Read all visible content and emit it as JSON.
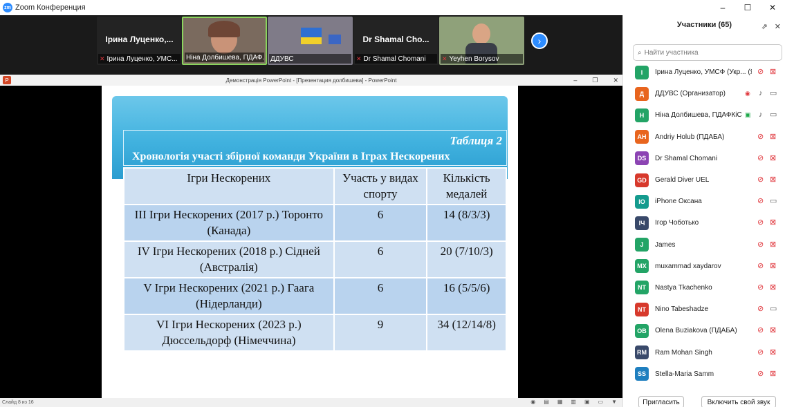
{
  "window": {
    "title": "Zoom Конференция",
    "controls": [
      "–",
      "☐",
      "✕"
    ]
  },
  "video_strip": {
    "tiles": [
      {
        "big_name": "Ірина Луценко,...",
        "caption": "Ірина Луценко, УМС...",
        "muted": true
      },
      {
        "big_name": "",
        "caption": "Ніна Долбишева, ПДАФ...",
        "muted": false
      },
      {
        "big_name": "",
        "caption": "ДДУВС",
        "muted": false
      },
      {
        "big_name": "Dr Shamal Cho...",
        "caption": "Dr Shamal Chomani",
        "muted": true
      },
      {
        "big_name": "",
        "caption": "Yeyhen Borysov",
        "muted": true
      }
    ],
    "next_icon": "chevron-right-icon"
  },
  "powerpoint": {
    "window_title": "Демонстрація PowerPoint - [Презентация долбишева] - PowerPoint",
    "status_text": "Слайд 8 из 16",
    "slide": {
      "caption_label": "Таблиця 2",
      "caption_title": "Хронологія участі збірної команди України в Іграх Нескорених",
      "table": {
        "headers": [
          "Ігри Нескорених",
          "Участь у видах спорту",
          "Кількість медалей"
        ],
        "rows": [
          [
            "III Ігри Нескорених (2017 р.) Торонто (Канада)",
            "6",
            "14 (8/3/3)"
          ],
          [
            "IV Ігри Нескорених (2018 р.) Сідней (Австралія)",
            "6",
            "20 (7/10/3)"
          ],
          [
            "V Ігри Нескорених (2021 р.) Гаага (Нідерланди)",
            "6",
            "16 (5/5/6)"
          ],
          [
            "VI Ігри Нескорених (2023 р.) Дюссельдорф (Німеччина)",
            "9",
            "34 (12/14/8)"
          ]
        ]
      }
    }
  },
  "participants_panel": {
    "title": "Участники (65)",
    "search_placeholder": "Найти участника",
    "participants": [
      {
        "initials": "І",
        "name": "Ірина Луценко, УМСФ (Укр... (Я)",
        "color": "#23a466",
        "mic": "off",
        "cam": "off"
      },
      {
        "initials": "Д",
        "name": "ДДУВС (Организатор)",
        "color": "#e8651e",
        "mic": "on",
        "cam": "on",
        "extra": "rec"
      },
      {
        "initials": "Н",
        "name": "Ніна Долбишева, ПДАФКіС",
        "color": "#23a466",
        "mic": "on",
        "cam": "on",
        "extra": "share"
      },
      {
        "initials": "AH",
        "name": "Andriy Holub (ПДАБА)",
        "color": "#e8651e",
        "mic": "off",
        "cam": "off"
      },
      {
        "initials": "DS",
        "name": "Dr  Shamal Chomani",
        "color": "#8c44b3",
        "mic": "off",
        "cam": "off"
      },
      {
        "initials": "GD",
        "name": "Gerald Diver UEL",
        "color": "#d7392c",
        "mic": "off",
        "cam": "off"
      },
      {
        "initials": "IO",
        "name": "iPhone Оксана",
        "color": "#149b8e",
        "mic": "off",
        "cam": "on"
      },
      {
        "initials": "ІЧ",
        "name": "Ігор Чоботько",
        "color": "#39496a",
        "mic": "off",
        "cam": "off"
      },
      {
        "initials": "J",
        "name": "James",
        "color": "#23a466",
        "mic": "off",
        "cam": "off"
      },
      {
        "initials": "MX",
        "name": "muxammad xaydarov",
        "color": "#23a466",
        "mic": "off",
        "cam": "off"
      },
      {
        "initials": "NT",
        "name": "Nastya Tkachenko",
        "color": "#23a466",
        "mic": "off",
        "cam": "off"
      },
      {
        "initials": "NT",
        "name": "Nino Tabeshadze",
        "color": "#d7392c",
        "mic": "off",
        "cam": "on"
      },
      {
        "initials": "OB",
        "name": "Olena Buziakova (ПДАБА)",
        "color": "#23a466",
        "mic": "off",
        "cam": "off"
      },
      {
        "initials": "RM",
        "name": "Ram Mohan Singh",
        "color": "#39496a",
        "mic": "off",
        "cam": "off"
      },
      {
        "initials": "SS",
        "name": "Stella-Maria Samm",
        "color": "#1f7fbf",
        "mic": "off",
        "cam": "off"
      }
    ],
    "invite_label": "Пригласить",
    "unmute_label": "Включить свой звук"
  }
}
